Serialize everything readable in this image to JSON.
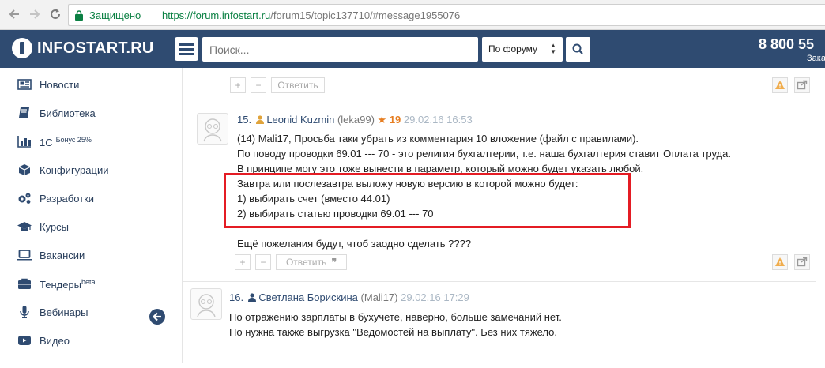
{
  "browser": {
    "secure_label": "Защищено",
    "url_scheme": "https://",
    "url_host": "forum.infostart.ru",
    "url_path": "/forum15/topic137710/#message1955076"
  },
  "header": {
    "logo_text": "INFOSTART.RU",
    "search_placeholder": "Поиск...",
    "scope_value": "По форуму",
    "phone": "8 800 55",
    "phone_sub": "Зака"
  },
  "sidebar": {
    "items": [
      {
        "label": "Новости",
        "icon": "news-icon"
      },
      {
        "label": "Библиотека",
        "icon": "book-icon"
      },
      {
        "label": "1С",
        "sup": "Бонус 25%",
        "icon": "chart-icon"
      },
      {
        "label": "Конфигурации",
        "icon": "cube-icon"
      },
      {
        "label": "Разработки",
        "icon": "gears-icon"
      },
      {
        "label": "Курсы",
        "icon": "graduation-cap-icon"
      },
      {
        "label": "Вакансии",
        "icon": "laptop-icon"
      },
      {
        "label": "Тендеры",
        "sup": "beta",
        "icon": "briefcase-icon"
      },
      {
        "label": "Вебинары",
        "icon": "microphone-icon"
      },
      {
        "label": "Видео",
        "icon": "video-icon"
      }
    ]
  },
  "toolbar_top": {
    "plus": "+",
    "minus": "−",
    "reply": "Ответить"
  },
  "comments": [
    {
      "num": "15.",
      "author": "Leonid Kuzmin",
      "login": "(leka99)",
      "rating": "19",
      "date": "29.02.16 16:53",
      "lines": [
        "(14) Mali17, Просьба таки убрать из комментария 10 вложение (файл с правилами).",
        "По поводу проводки 69.01 --- 70 - это религия бухгалтерии, т.е. наша бухгалтерия ставит Оплата труда.",
        "В принципе могу это тоже вынести в параметр, который можно будет указать любой.",
        "Завтра или послезавтра выложу новую версию в которой можно будет:",
        "1) выбирать счет (вместо 44.01)",
        "2) выбирать статью проводки 69.01 --- 70",
        "Ещё пожелания будут, чтоб заодно сделать ????"
      ],
      "plus": "+",
      "minus": "−",
      "reply": "Ответить"
    },
    {
      "num": "16.",
      "author": "Светлана Борискина",
      "login": "(Mali17)",
      "date": "29.02.16 17:29",
      "lines": [
        "По отражению зарплаты в бухучете, наверно, больше замечаний нет.",
        "Но нужна также выгрузка \"Ведомостей на выплату\". Без них тяжело."
      ]
    }
  ],
  "colors": {
    "header_bg": "#2f4b71",
    "highlight": "#e41c24",
    "date": "#aab7c4",
    "rating": "#e67e22"
  }
}
